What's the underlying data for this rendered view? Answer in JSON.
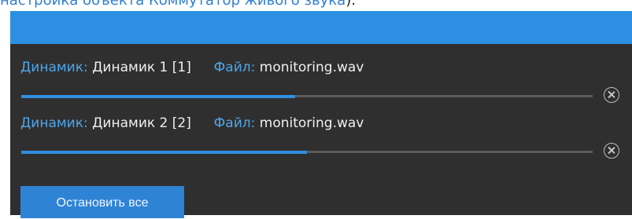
{
  "top_text": {
    "link": "настройка объекта Коммутатор живого звука",
    "tail": ")."
  },
  "rows": [
    {
      "speaker_key": "Динамик:",
      "speaker_value": "Динамик 1 [1]",
      "file_key": "Файл:",
      "file_value": "monitoring.wav",
      "progress": 0.48
    },
    {
      "speaker_key": "Динамик:",
      "speaker_value": "Динамик 2 [2]",
      "file_key": "Файл:",
      "file_value": "monitoring.wav",
      "progress": 0.5
    }
  ],
  "actions": {
    "stop_all": "Остановить все"
  },
  "colors": {
    "header": "#2d8fe2",
    "body": "#2f2f2f",
    "accent": "#2f8fe0",
    "label": "#4ea6ea"
  }
}
